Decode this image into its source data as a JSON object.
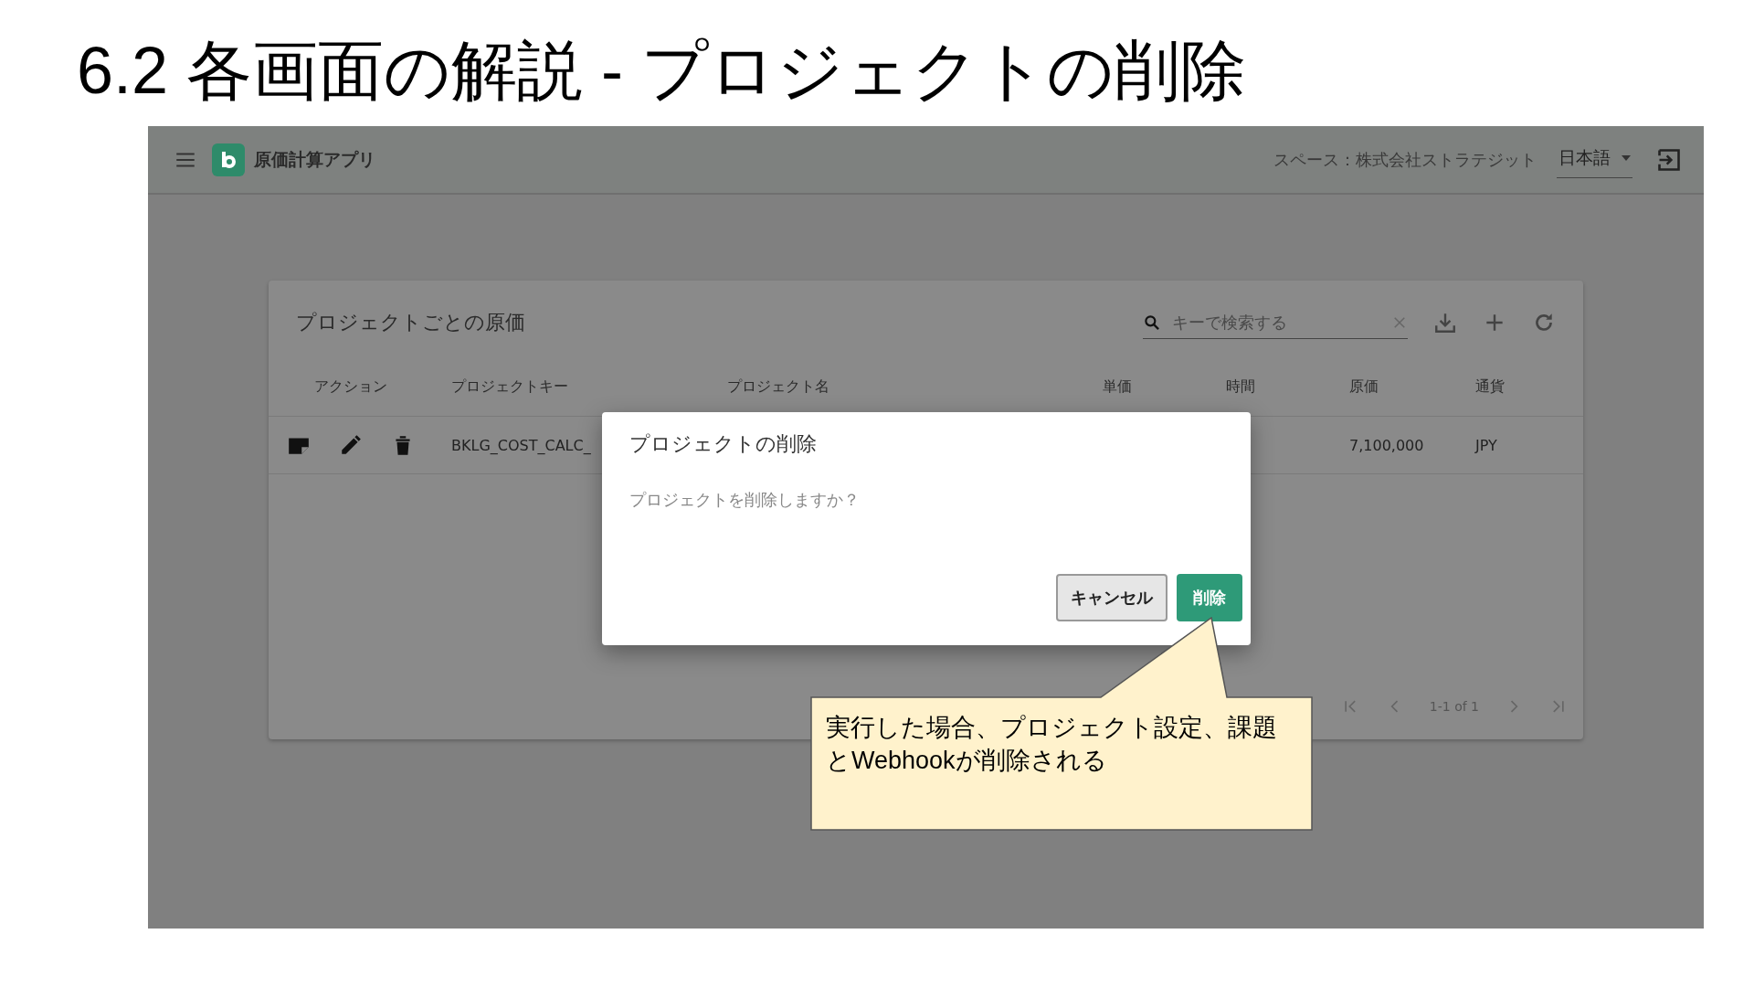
{
  "slide_title": "6.2 各画面の解説 - プロジェクトの削除",
  "app": {
    "app_name": "原価計算アプリ",
    "space_label": "スペース：株式会社ストラテジット",
    "language": "日本語"
  },
  "card": {
    "title": "プロジェクトごとの原価",
    "search": {
      "placeholder": "キーで検索する"
    },
    "columns": [
      "アクション",
      "プロジェクトキー",
      "プロジェクト名",
      "単価",
      "時間",
      "原価",
      "通貨"
    ],
    "rows": [
      {
        "key": "BKLG_COST_CALC_",
        "cost": "7,100,000",
        "currency": "JPY"
      }
    ],
    "pagination": {
      "range": "1-1 of 1"
    }
  },
  "dialog": {
    "title": "プロジェクトの削除",
    "message": "プロジェクトを削除しますか？",
    "buttons": [
      {
        "label": "キャンセル",
        "kind": "secondary"
      },
      {
        "label": "削除",
        "kind": "primary"
      }
    ]
  },
  "callout": {
    "text": "実行した場合、プロジェクト設定、課題とWebhookが削除される"
  }
}
